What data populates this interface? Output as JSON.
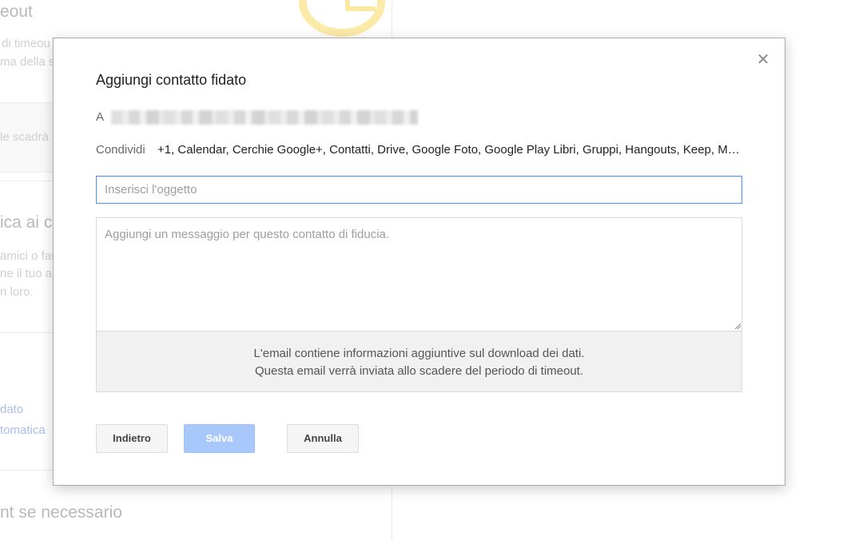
{
  "background": {
    "heading_top": "eout",
    "line_1": "di timeou",
    "line_2": "ma della s",
    "box_text": "le scadrà",
    "heading_mid": "ica ai c",
    "line_3": "amici o far",
    "line_4": "ne il tuo a",
    "line_5": "n loro.",
    "link_1": "dato",
    "link_2": "tomatica",
    "heading_bottom": "nt se necessario"
  },
  "dialog": {
    "title": "Aggiungi contatto fidato",
    "close_glyph": "✕",
    "to_label": "A",
    "share_label": "Condividi",
    "share_services": "+1, Calendar, Cerchie Google+, Contatti, Drive, Google Foto, Google Play Libri, Gruppi, Hangouts, Keep, Maps, YouTube",
    "subject_placeholder": "Inserisci l'oggetto",
    "message_placeholder": "Aggiungi un messaggio per questo contatto di fiducia.",
    "info_line_1": "L'email contiene informazioni aggiuntive sul download dei dati.",
    "info_line_2": "Questa email verrà inviata allo scadere del periodo di timeout.",
    "buttons": {
      "back": "Indietro",
      "save": "Salva",
      "cancel": "Annulla"
    }
  },
  "colors": {
    "focus_border": "#4d90fe",
    "save_button_disabled": "#a8c8fb"
  }
}
